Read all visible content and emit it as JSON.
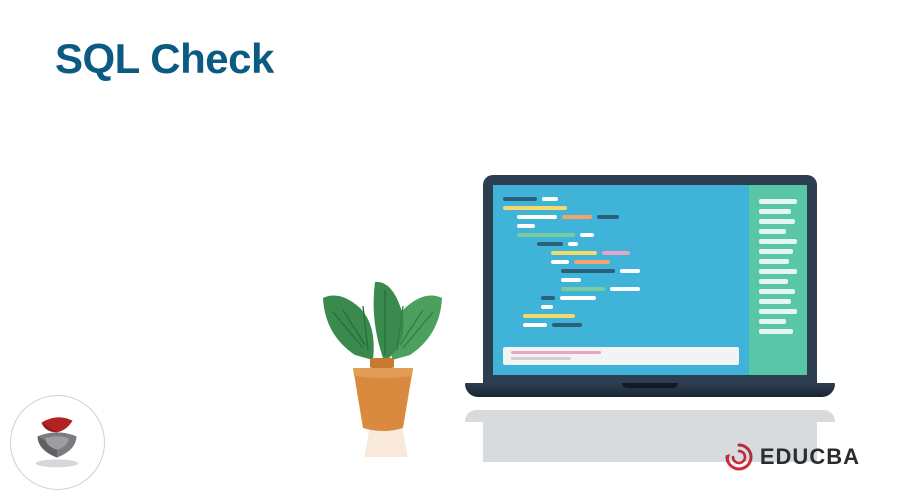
{
  "title": "SQL Check",
  "brand": {
    "name": "EDUCBA"
  },
  "colors": {
    "title": "#0b5a82",
    "laptop_bezel": "#2c3e50",
    "code_bg": "#3fb4d8",
    "sidebar_bg": "#59c6a8",
    "pot": "#d98a3e",
    "leaf": "#3a8a4d",
    "educba_accent": "#d62839"
  }
}
